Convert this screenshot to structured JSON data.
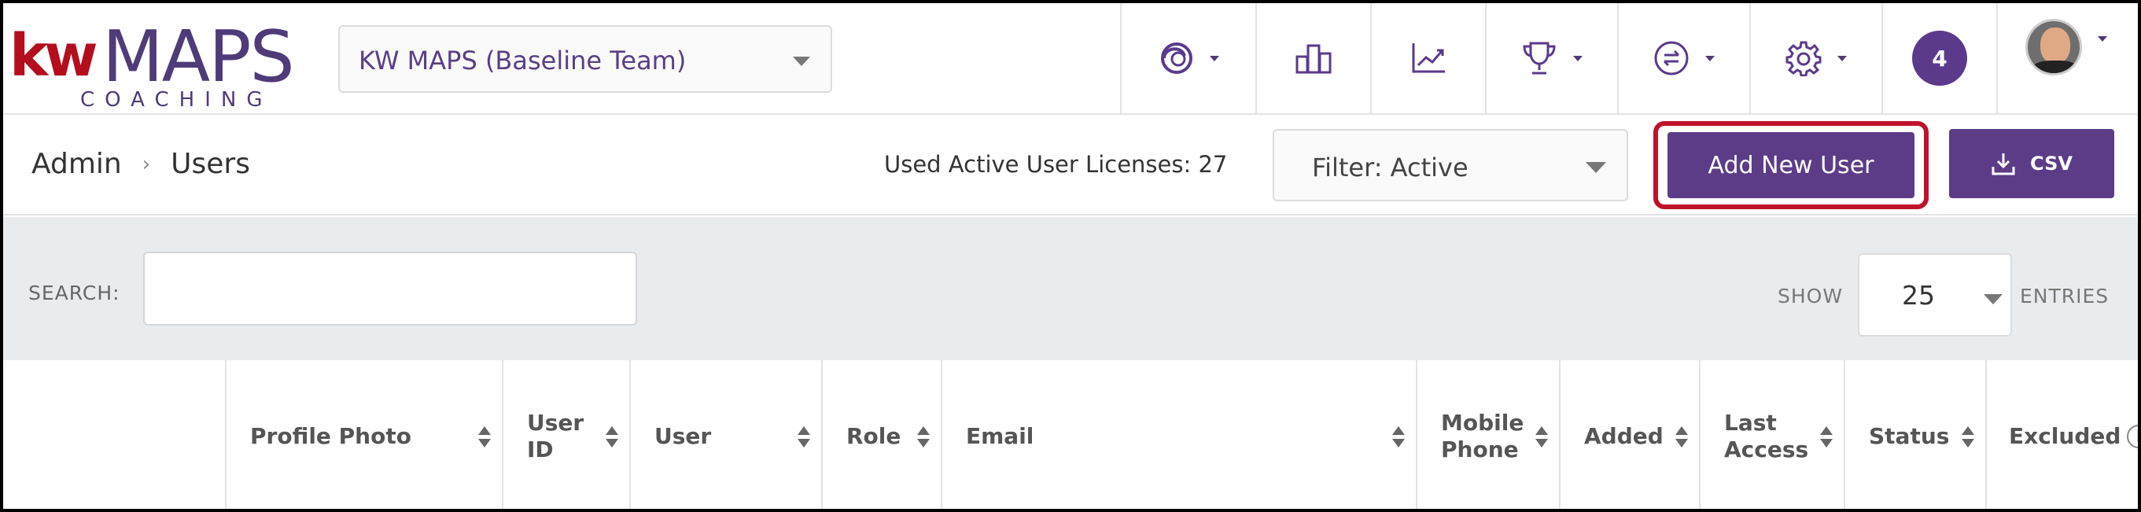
{
  "brand": {
    "logo_kw": "kw",
    "logo_maps": "MAPS",
    "logo_sub": "COACHING"
  },
  "header": {
    "team_select": "KW MAPS (Baseline Team)",
    "notification_count": "4",
    "icons": [
      "coaching-swirl-icon",
      "podium-icon",
      "trending-chart-icon",
      "trophy-icon",
      "swap-arrows-icon",
      "gear-icon"
    ]
  },
  "breadcrumb": {
    "root": "Admin",
    "current": "Users"
  },
  "licenses": "Used Active User Licenses: 27",
  "filter": "Filter: Active",
  "actions": {
    "add_user": "Add New User",
    "csv": "CSV"
  },
  "toolbar": {
    "search_label": "SEARCH:",
    "show_label": "SHOW",
    "entries_value": "25",
    "entries_label": "ENTRIES"
  },
  "table": {
    "columns": [
      {
        "key": "profile_photo",
        "label": "Profile Photo"
      },
      {
        "key": "user_id",
        "label": "User\nID"
      },
      {
        "key": "user",
        "label": "User"
      },
      {
        "key": "role",
        "label": "Role"
      },
      {
        "key": "email",
        "label": "Email"
      },
      {
        "key": "mobile_phone",
        "label": "Mobile\nPhone"
      },
      {
        "key": "added",
        "label": "Added"
      },
      {
        "key": "last_access",
        "label": "Last\nAccess"
      },
      {
        "key": "status",
        "label": "Status"
      },
      {
        "key": "excluded",
        "label": "Excluded"
      }
    ]
  },
  "colors": {
    "brand_purple": "#5c3c87",
    "brand_red": "#b40d1e",
    "highlight_red": "#c0122a"
  }
}
